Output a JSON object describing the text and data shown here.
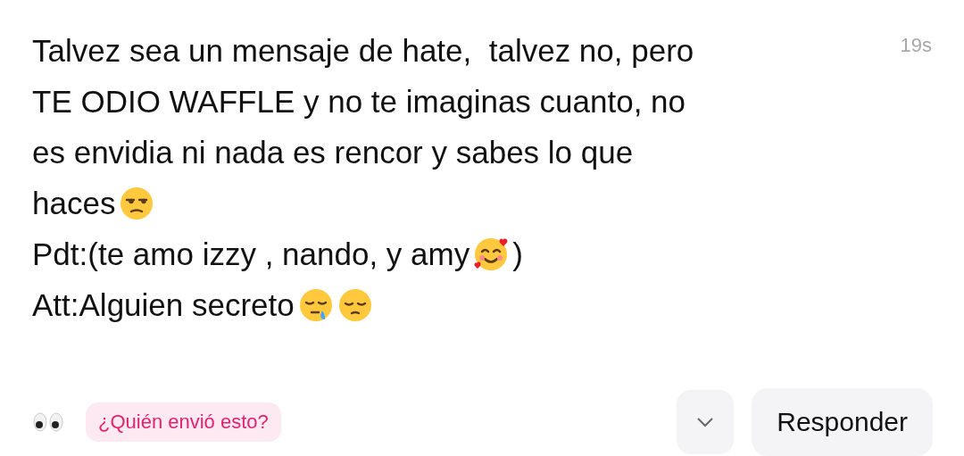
{
  "message": {
    "lines": [
      [
        {
          "kind": "text",
          "text": "Talvez sea un mensaje de hate,  talvez no, pero"
        }
      ],
      [
        {
          "kind": "text",
          "text": "TE ODIO WAFFLE y no te imaginas cuanto, no"
        }
      ],
      [
        {
          "kind": "text",
          "text": "es envidia ni nada es rencor y sabes lo que"
        }
      ],
      [
        {
          "kind": "text",
          "text": "haces"
        },
        {
          "kind": "unamused"
        }
      ],
      [
        {
          "kind": "text",
          "text": "Pdt:(te amo izzy , nando, y amy"
        },
        {
          "kind": "hearts"
        },
        {
          "kind": "text",
          "text": ")"
        }
      ],
      [
        {
          "kind": "text",
          "text": "Att:Alguien secreto"
        },
        {
          "kind": "sleepy"
        },
        {
          "kind": "pensive"
        }
      ]
    ],
    "time": "19s"
  },
  "footer": {
    "hint": "¿Quién envió esto?",
    "reply": "Responder"
  }
}
